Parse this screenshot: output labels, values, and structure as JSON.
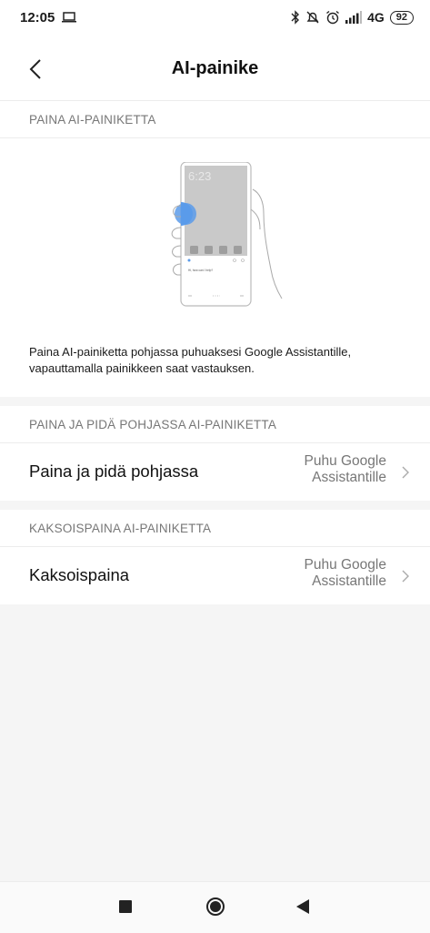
{
  "status_bar": {
    "time": "12:05",
    "network": "4G",
    "battery": "92",
    "icons": [
      "laptop-icon",
      "bluetooth-icon",
      "mute-icon",
      "alarm-icon",
      "signal-icon"
    ]
  },
  "header": {
    "title": "AI-painike",
    "back_icon": "chevron-left-icon"
  },
  "press_section": {
    "header": "PAINA AI-PAINIKETTA",
    "illustration": {
      "clock": "6:23",
      "question": "Hi, how can I help?"
    },
    "description": "Paina AI-painiketta pohjassa puhuaksesi Google Assistantille, vapauttamalla painikkeen saat vastauksen."
  },
  "hold_section": {
    "header": "PAINA JA PIDÄ POHJASSA AI-PAINIKETTA",
    "row": {
      "title": "Paina ja pidä pohjassa",
      "value_line1": "Puhu Google",
      "value_line2": "Assistantille"
    }
  },
  "double_section": {
    "header": "KAKSOISPAINA AI-PAINIKETTA",
    "row": {
      "title": "Kaksoispaina",
      "value_line1": "Puhu Google",
      "value_line2": "Assistantille"
    }
  },
  "colors": {
    "accent": "#5b9bea",
    "background": "#f5f5f5",
    "section_header": "#777777"
  }
}
